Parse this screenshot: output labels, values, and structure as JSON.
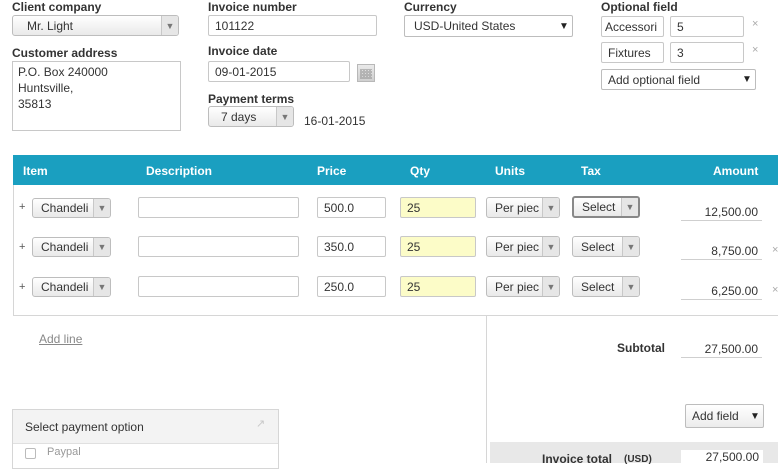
{
  "client": {
    "label": "Client company",
    "value": "Mr. Light"
  },
  "customer_address": {
    "label": "Customer address",
    "value": "P.O. Box 240000\nHuntsville,\n35813"
  },
  "invoice_number": {
    "label": "Invoice number",
    "value": "101122"
  },
  "invoice_date": {
    "label": "Invoice date",
    "value": "09-01-2015"
  },
  "payment_terms": {
    "label": "Payment terms",
    "value": "7 days",
    "due_date": "16-01-2015"
  },
  "currency": {
    "label": "Currency",
    "value": "USD-United States"
  },
  "optional_field": {
    "label": "Optional field",
    "rows": [
      {
        "name": "Accessori",
        "value": "5"
      },
      {
        "name": "Fixtures",
        "value": "3"
      }
    ],
    "add_label": "Add optional field"
  },
  "table": {
    "headers": {
      "item": "Item",
      "description": "Description",
      "price": "Price",
      "qty": "Qty",
      "units": "Units",
      "tax": "Tax",
      "amount": "Amount"
    },
    "rows": [
      {
        "plus": "+",
        "item": "Chandeli",
        "description": "",
        "price": "500.0",
        "qty": "25",
        "units": "Per piec",
        "tax": "Select",
        "amount": "12,500.00",
        "remove": ""
      },
      {
        "plus": "+",
        "item": "Chandeli",
        "description": "",
        "price": "350.0",
        "qty": "25",
        "units": "Per piec",
        "tax": "Select",
        "amount": "8,750.00",
        "remove": "×"
      },
      {
        "plus": "+",
        "item": "Chandeli",
        "description": "",
        "price": "250.0",
        "qty": "25",
        "units": "Per piec",
        "tax": "Select",
        "amount": "6,250.00",
        "remove": "×"
      }
    ]
  },
  "add_line": "Add line",
  "subtotal": {
    "label": "Subtotal",
    "value": "27,500.00"
  },
  "add_field": "Add field",
  "payment": {
    "title": "Select payment option",
    "options": [
      "Paypal"
    ]
  },
  "invoice_total": {
    "label": "Invoice total",
    "currency": "(USD)",
    "value": "27,500.00"
  },
  "icons": {
    "calendar": "calendar-icon",
    "dropdown": "chevron-down-icon",
    "remove": "close-icon",
    "expand": "expand-arrow-icon"
  },
  "colors": {
    "table_header": "#1a9fc0",
    "qty_highlight": "#fcfcc8"
  }
}
